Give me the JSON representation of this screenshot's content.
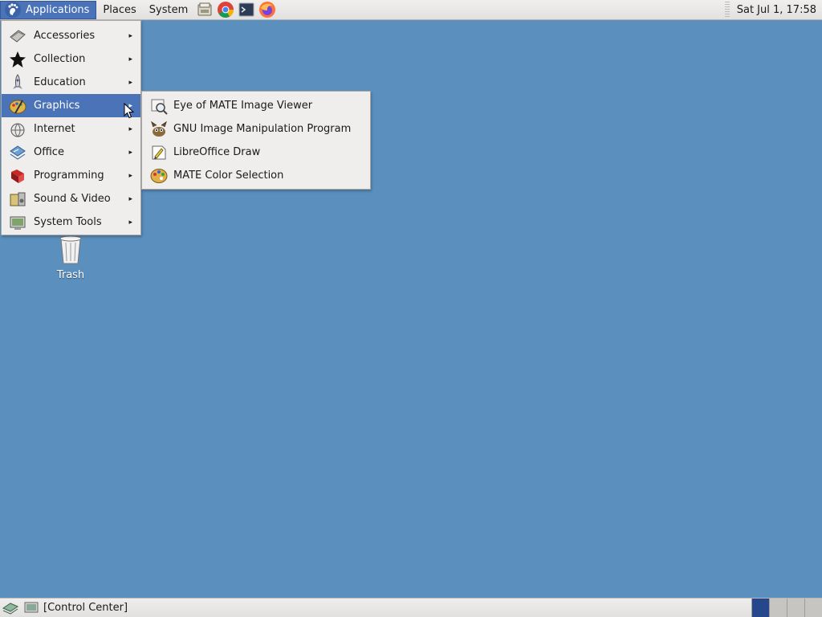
{
  "top_panel": {
    "applications": "Applications",
    "places": "Places",
    "system": "System",
    "clock": "Sat Jul 1, 17:58"
  },
  "launchers": [
    {
      "icon": "file-manager-icon"
    },
    {
      "icon": "chrome-icon"
    },
    {
      "icon": "terminal-icon"
    },
    {
      "icon": "firefox-icon"
    }
  ],
  "applications_menu": {
    "items": [
      {
        "label": "Accessories",
        "icon": "accessories-icon"
      },
      {
        "label": "Collection",
        "icon": "star-icon"
      },
      {
        "label": "Education",
        "icon": "education-icon"
      },
      {
        "label": "Graphics",
        "icon": "graphics-icon",
        "active": true
      },
      {
        "label": "Internet",
        "icon": "internet-icon"
      },
      {
        "label": "Office",
        "icon": "office-icon"
      },
      {
        "label": "Programming",
        "icon": "programming-icon"
      },
      {
        "label": "Sound & Video",
        "icon": "multimedia-icon"
      },
      {
        "label": "System Tools",
        "icon": "system-tools-icon"
      }
    ],
    "arrow": "▸"
  },
  "graphics_submenu": {
    "items": [
      {
        "label": "Eye of MATE Image Viewer",
        "icon": "image-viewer-icon"
      },
      {
        "label": "GNU Image Manipulation Program",
        "icon": "gimp-icon"
      },
      {
        "label": "LibreOffice Draw",
        "icon": "libreoffice-draw-icon"
      },
      {
        "label": "MATE Color Selection",
        "icon": "color-palette-icon"
      }
    ]
  },
  "desktop": {
    "trash_label": "Trash"
  },
  "bottom_panel": {
    "task_label": "[Control Center]"
  },
  "colors": {
    "desktop": "#5b8fbe",
    "highlight": "#4a73b8",
    "workspace_active": "#27478c"
  }
}
